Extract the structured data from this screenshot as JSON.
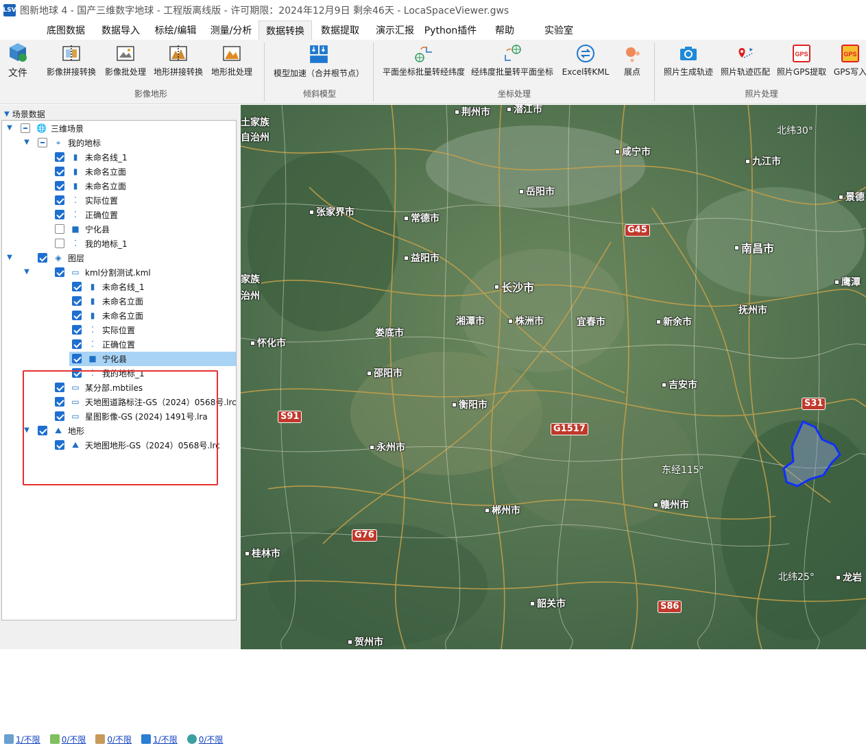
{
  "window": {
    "logo": "LSV",
    "title": "图新地球 4 - 国产三维数字地球 - 工程版离线版 - 许可期限：2024年12月9日 剩余46天 - LocaSpaceViewer.gws"
  },
  "menu": [
    "底图数据",
    "数据导入",
    "标绘/编辑",
    "测量/分析",
    "数据转换",
    "数据提取",
    "演示汇报",
    "Python插件",
    "帮助",
    "实验室"
  ],
  "ribbon": {
    "file_label": "文件",
    "buttons": [
      "影像拼接转换",
      "影像批处理",
      "地形拼接转换",
      "地形批处理",
      "模型加速（合并根节点）",
      "平面坐标批量转经纬度",
      "经纬度批量转平面坐标",
      "Excel转KML",
      "展点",
      "照片生成轨迹",
      "照片轨迹匹配",
      "照片GPS提取",
      "GPS写入"
    ],
    "groups": [
      "影像地形",
      "倾斜模型",
      "坐标处理",
      "照片处理"
    ],
    "gps_badge": "GPS"
  },
  "panel": {
    "header": "场景数据",
    "tree": [
      "三维场景",
      "我的地标",
      "未命名线_1",
      "未命名立面",
      "未命名立面",
      "实际位置",
      "正确位置",
      "宁化县",
      "我的地标_1",
      "图层",
      "kml分割测试.kml",
      "未命名线_1",
      "未命名立面",
      "未命名立面",
      "实际位置",
      "正确位置",
      "宁化县",
      "我的地标_1",
      "某分部.mbtiles",
      "天地图道路标注-GS（2024）0568号.lrc",
      "星图影像-GS (2024) 1491号.lra",
      "地形",
      "天地图地形-GS（2024）0568号.lrc"
    ]
  },
  "status": [
    "1/不限",
    "0/不限",
    "0/不限",
    "1/不限",
    "0/不限"
  ],
  "map": {
    "cities": [
      "荆州市",
      "潜江市",
      "土家族",
      "自治州",
      "咸宁市",
      "九江市",
      "岳阳市",
      "张家界市",
      "常德市",
      "南昌市",
      "益阳市",
      "家族",
      "治州",
      "长沙市",
      "鹰潭",
      "湘潭市",
      "株洲市",
      "宜春市",
      "新余市",
      "抚州市",
      "怀化市",
      "娄底市",
      "邵阳市",
      "吉安市",
      "衡阳市",
      "永州市",
      "赣州市",
      "郴州市",
      "桂林市",
      "韶关市",
      "贺州市",
      "龙岩",
      "景德"
    ],
    "roads": [
      "G45",
      "S91",
      "G1517",
      "S31",
      "G76",
      "S86"
    ],
    "labels": [
      "北纬30°",
      "东经115°",
      "北纬25°"
    ]
  }
}
